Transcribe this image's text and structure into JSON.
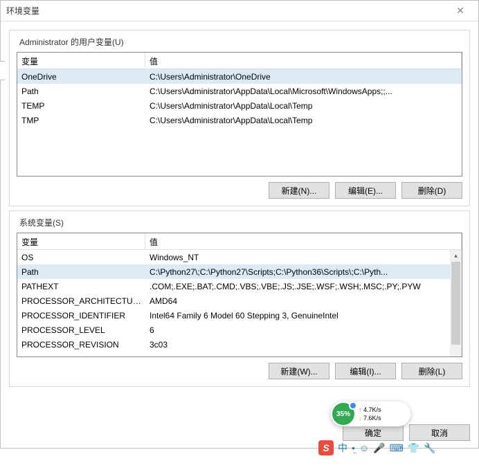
{
  "window": {
    "title": "环境变量"
  },
  "user_section": {
    "label": "Administrator 的用户变量(U)",
    "cols": {
      "var": "变量",
      "val": "值"
    },
    "rows": [
      {
        "var": "OneDrive",
        "val": "C:\\Users\\Administrator\\OneDrive",
        "sel": true
      },
      {
        "var": "Path",
        "val": "C:\\Users\\Administrator\\AppData\\Local\\Microsoft\\WindowsApps;;..."
      },
      {
        "var": "TEMP",
        "val": "C:\\Users\\Administrator\\AppData\\Local\\Temp"
      },
      {
        "var": "TMP",
        "val": "C:\\Users\\Administrator\\AppData\\Local\\Temp"
      }
    ],
    "buttons": {
      "new": "新建(N)...",
      "edit": "编辑(E)...",
      "del": "删除(D)"
    }
  },
  "sys_section": {
    "label": "系统变量(S)",
    "cols": {
      "var": "变量",
      "val": "值"
    },
    "rows": [
      {
        "var": "OS",
        "val": "Windows_NT"
      },
      {
        "var": "Path",
        "val": "C:\\Python27\\;C:\\Python27\\Scripts;C:\\Python36\\Scripts\\;C:\\Pyth...",
        "sel": true
      },
      {
        "var": "PATHEXT",
        "val": ".COM;.EXE;.BAT;.CMD;.VBS;.VBE;.JS;.JSE;.WSF;.WSH;.MSC;.PY;.PYW"
      },
      {
        "var": "PROCESSOR_ARCHITECTURE",
        "val": "AMD64"
      },
      {
        "var": "PROCESSOR_IDENTIFIER",
        "val": "Intel64 Family 6 Model 60 Stepping 3, GenuineIntel"
      },
      {
        "var": "PROCESSOR_LEVEL",
        "val": "6"
      },
      {
        "var": "PROCESSOR_REVISION",
        "val": "3c03"
      }
    ],
    "buttons": {
      "new": "新建(W)...",
      "edit": "编辑(I)...",
      "del": "删除(L)"
    }
  },
  "dialog_buttons": {
    "ok": "确定",
    "cancel": "取消"
  },
  "net_widget": {
    "pct": "35%",
    "up": "4.7K/s",
    "dn": "7.6K/s"
  },
  "tray": {
    "ime": "中"
  }
}
